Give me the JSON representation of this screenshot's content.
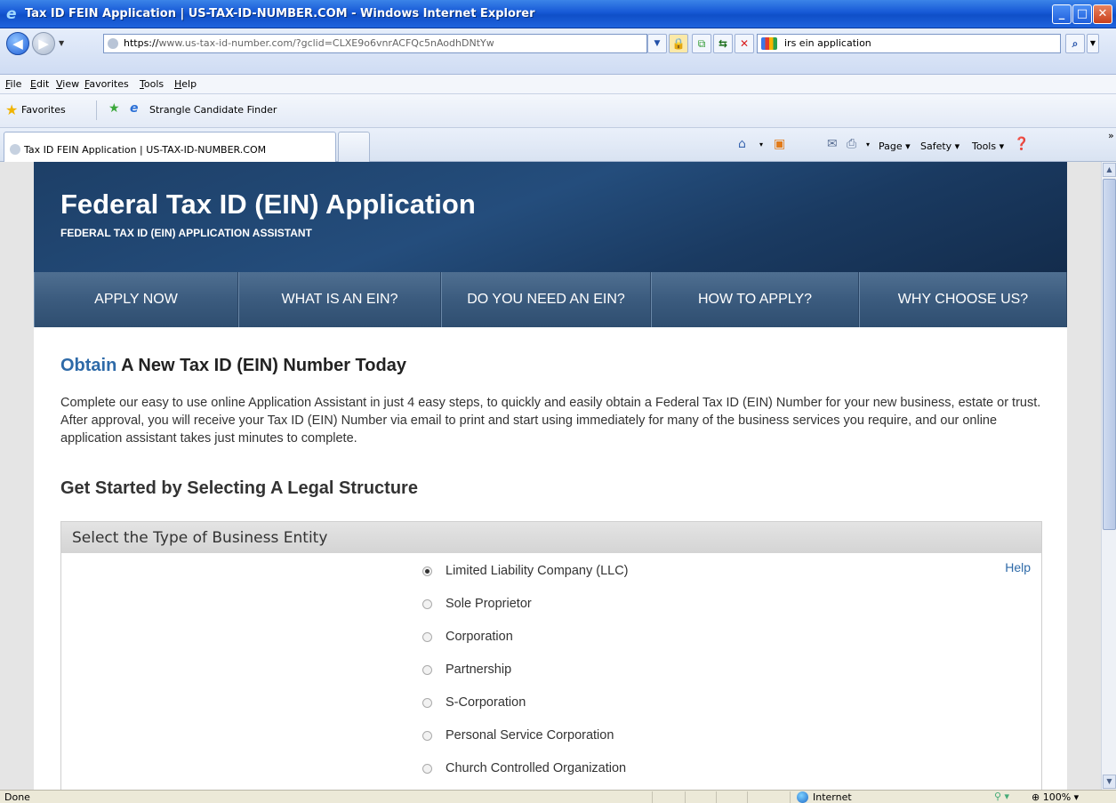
{
  "window": {
    "title": "Tax ID FEIN Application | US-TAX-ID-NUMBER.COM - Windows Internet Explorer",
    "min_label": "_",
    "max_label": "□",
    "close_label": "✕"
  },
  "address": {
    "url_prefix": "https://",
    "url_host": "www.us-tax-id-number.com",
    "url_path": "/?gclid=CLXE9o6vnrACFQc5nAodhDNtYw",
    "search_value": "irs ein application"
  },
  "menu": [
    "File",
    "Edit",
    "View",
    "Favorites",
    "Tools",
    "Help"
  ],
  "favorites_bar": {
    "label": "Favorites",
    "link": "Strangle Candidate Finder"
  },
  "tab": {
    "title": "Tax ID FEIN Application | US-TAX-ID-NUMBER.COM"
  },
  "command_bar": {
    "page": "Page ▾",
    "safety": "Safety ▾",
    "tools": "Tools ▾",
    "more": "»"
  },
  "site": {
    "title": "Federal Tax ID (EIN) Application",
    "subtitle": "FEDERAL TAX ID (EIN) APPLICATION ASSISTANT",
    "nav": [
      "APPLY NOW",
      "WHAT IS AN EIN?",
      "DO YOU NEED AN EIN?",
      "HOW TO APPLY?",
      "WHY CHOOSE US?"
    ],
    "heading_accent": "Obtain",
    "heading_rest": " A New Tax ID (EIN) Number Today",
    "intro": "Complete our easy to use online Application Assistant in just 4 easy steps, to quickly and easily obtain a Federal Tax ID (EIN) Number for your new business, estate or trust. After approval, you will receive your Tax ID (EIN) Number via email to print and start using immediately for many of the business services you require, and our online application assistant takes just minutes to complete.",
    "subheading": "Get Started by Selecting A Legal Structure",
    "entity_box_title": "Select the Type of Business Entity",
    "help": "Help",
    "entities": [
      {
        "label": "Limited Liability Company (LLC)",
        "checked": true
      },
      {
        "label": "Sole Proprietor",
        "checked": false
      },
      {
        "label": "Corporation",
        "checked": false
      },
      {
        "label": "Partnership",
        "checked": false
      },
      {
        "label": "S-Corporation",
        "checked": false
      },
      {
        "label": "Personal Service Corporation",
        "checked": false
      },
      {
        "label": "Church Controlled Organization",
        "checked": false
      }
    ]
  },
  "status": {
    "text": "Done",
    "zone": "Internet",
    "zoom": "100%"
  }
}
